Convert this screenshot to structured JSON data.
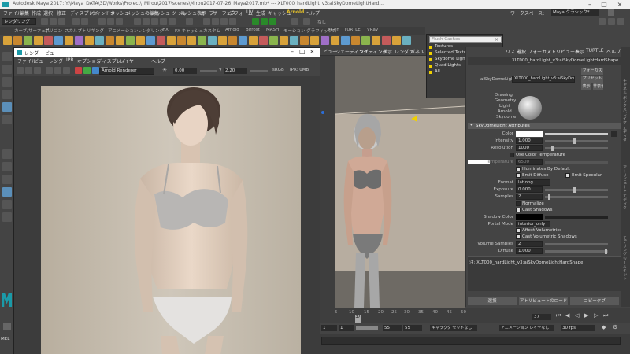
{
  "window": {
    "title": "Autodesk Maya 2017: Y:\\Maya_DATA\\3D\\Works\\Project\\_Mirou\\2017\\scenes\\Mirou2017-07-26_Maya2017.mb*  ---  XLT000_hardLight_v3:aiSkyDomeLightHard..."
  },
  "menubar": {
    "items": [
      "ファイル",
      "編集",
      "作成",
      "選択",
      "修正",
      "ディスプレイ",
      "ウィンドウ",
      "メッシュ",
      "メッシュの編集",
      "メッシュ ツール",
      "メッシュ表示",
      "カーブ",
      "サーフェス",
      "デフォーム",
      "UV",
      "生成",
      "キャッシュ",
      "Arnold",
      "ヘルプ"
    ],
    "workspace_label": "ワークスペース:",
    "workspace_value": "Maya クラシック*"
  },
  "statusline": {
    "mode": "レンダリング",
    "renderer": "なし"
  },
  "shelf": {
    "tabs": [
      "カーブ/サーフェス",
      "ポリゴン",
      "スカルプト",
      "リギング",
      "アニメーション",
      "レンダリング",
      "FX",
      "FX キャッシュ",
      "カスタム",
      "Arnold",
      "Bifrost",
      "MASH",
      "モーション グラフィックス",
      "XGen",
      "TURTLE",
      "VRay"
    ],
    "icon_colors": [
      "#d8a23a",
      "#c8872f",
      "#8ab44d",
      "#d8a23a",
      "#c45b5b",
      "#5d9ad0",
      "#d8a23a",
      "#9f6fc7",
      "#d8a23a",
      "#6ab0c0",
      "#c8872f",
      "#d8a23a",
      "#8ab44d",
      "#d8a23a",
      "#5d9ad0",
      "#c45b5b",
      "#d8a23a",
      "#c8872f",
      "#d8a23a",
      "#8ab44d",
      "#6ab0c0",
      "#d8a23a",
      "#c8872f",
      "#5d9ad0",
      "#d8a23a",
      "#c45b5b",
      "#8ab44d",
      "#d8a23a",
      "#6ab0c0",
      "#c8872f",
      "#d8a23a",
      "#9f6fc7",
      "#d8a23a",
      "#5d9ad0",
      "#c8872f",
      "#8ab44d",
      "#d8a23a",
      "#c45b5b",
      "#d8a23a",
      "#6ab0c0"
    ]
  },
  "renderview": {
    "title": "レンダー ビュー",
    "menus": [
      "ファイル",
      "ビュー",
      "レンダー",
      "IPR",
      "オプション",
      "ディスプレイ",
      "レイヤ",
      "ヘルプ"
    ],
    "renderer": "Arnold Renderer",
    "exposure": "0.00",
    "gamma": "2.20",
    "colorspace": "sRGB",
    "ipr_label": "IPR: 0MB"
  },
  "viewport": {
    "menus": [
      "ビュー",
      "シェーディング",
      "ライティング",
      "表示",
      "レンダラ",
      "パネル"
    ]
  },
  "popup": {
    "search_placeholder": "Flush Caches",
    "items": [
      "Textures",
      "Selected Textures",
      "Skydome Lights",
      "Quad Lights",
      "All"
    ]
  },
  "attr_editor": {
    "tabs": [
      "リスト",
      "選択",
      "フォーカス",
      "アトリビュート",
      "表示",
      "TURTLE",
      "ヘルプ"
    ],
    "node_name": "XLT000_hardLight_v3:aiSkyDomeLightHardShape",
    "type_label": "aiSkyDomeLight:",
    "shape_value": "XLT000_hardLight_v3:aiSkyDomeLightHardShape",
    "focus_btn": "フォーカス",
    "preset_btn": "プリセット",
    "show_btn": "表示",
    "hide_btn": "非表示",
    "swatch_text": [
      "Drawing",
      "Geometry",
      "Light",
      "Arnold",
      "Skydome"
    ],
    "section_title": "SkyDomeLight Attributes",
    "rows": {
      "color_label": "Color",
      "intensity_label": "Intensity",
      "intensity_value": "1.000",
      "resolution_label": "Resolution",
      "resolution_value": "1000",
      "use_color_temp": "Use Color Temperature",
      "temperature_label": "Temperature",
      "temperature_value": "6500",
      "illuminates_default": "Illuminates By Default",
      "emit_diffuse": "Emit Diffuse",
      "emit_specular": "Emit Specular",
      "format_label": "Format",
      "format_value": "latlong",
      "exposure_label": "Exposure",
      "exposure_value": "0.000",
      "samples_label": "Samples",
      "samples_value": "2",
      "normalize": "Normalize",
      "cast_shadows": "Cast Shadows",
      "shadow_color_label": "Shadow Color",
      "portal_mode_label": "Portal Mode",
      "portal_mode_value": "interior_only",
      "affect_volumetrics": "Affect Volumetrics",
      "cast_volumetric_shadows": "Cast Volumetric Shadows",
      "volume_samples_label": "Volume Samples",
      "volume_samples_value": "2",
      "diffuse_label": "Diffuse",
      "diffuse_value": "1.000"
    },
    "notes": "注: XLT000_hardLight_v3:aiSkyDomeLightHardShape",
    "footer": [
      "選択",
      "アトリビュートのロード",
      "コピータブ"
    ]
  },
  "timeline": {
    "ticks": [
      "5",
      "10",
      "15",
      "20",
      "25",
      "30",
      "35",
      "40",
      "45",
      "50"
    ],
    "current_frame_marker": "37",
    "current_frame": "37",
    "range_start": "1",
    "range_end": "55",
    "range_end2": "55",
    "anim_start": "1",
    "anim_end": "55",
    "charset": "キャラクタ セットなし",
    "animlayer": "アニメーション レイヤなし",
    "fps": "30 fps"
  },
  "bottom": {
    "mel_label": "MEL"
  },
  "colors": {
    "arnold_menu": "#e6c229",
    "highlight_yellow": "#f0d000",
    "section_header": "#5a5a5a"
  }
}
